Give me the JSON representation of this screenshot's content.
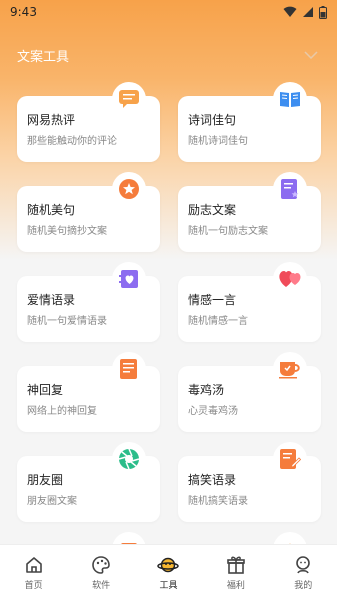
{
  "status_bar": {
    "time": "9:43"
  },
  "header": {
    "title": "文案工具"
  },
  "cards": [
    {
      "title": "网易热评",
      "subtitle": "那些能触动你的评论",
      "icon": "message-icon"
    },
    {
      "title": "诗词佳句",
      "subtitle": "随机诗词佳句",
      "icon": "book-icon"
    },
    {
      "title": "随机美句",
      "subtitle": "随机美句摘抄文案",
      "icon": "star-badge-icon"
    },
    {
      "title": "励志文案",
      "subtitle": "随机一句励志文案",
      "icon": "doc-star-icon"
    },
    {
      "title": "爱情语录",
      "subtitle": "随机一句爱情语录",
      "icon": "heart-card-icon"
    },
    {
      "title": "情感一言",
      "subtitle": "随机情感一言",
      "icon": "hearts-icon"
    },
    {
      "title": "神回复",
      "subtitle": "网络上的神回复",
      "icon": "note-icon"
    },
    {
      "title": "毒鸡汤",
      "subtitle": "心灵毒鸡汤",
      "icon": "cup-icon"
    },
    {
      "title": "朋友圈",
      "subtitle": "朋友圈文案",
      "icon": "aperture-icon"
    },
    {
      "title": "搞笑语录",
      "subtitle": "随机搞笑语录",
      "icon": "edit-doc-icon"
    }
  ],
  "bottom_nav": [
    {
      "label": "首页",
      "icon": "home-icon"
    },
    {
      "label": "软件",
      "icon": "palette-icon"
    },
    {
      "label": "工具",
      "icon": "planet-icon",
      "active": true
    },
    {
      "label": "福利",
      "icon": "gift-icon"
    },
    {
      "label": "我的",
      "icon": "user-icon"
    }
  ],
  "colors": {
    "accent": "#f7a24a",
    "orange": "#f57c3c",
    "purple": "#8c6cf0",
    "blue": "#3d8ef0",
    "red": "#f04b5a",
    "green": "#2bbd8a"
  }
}
